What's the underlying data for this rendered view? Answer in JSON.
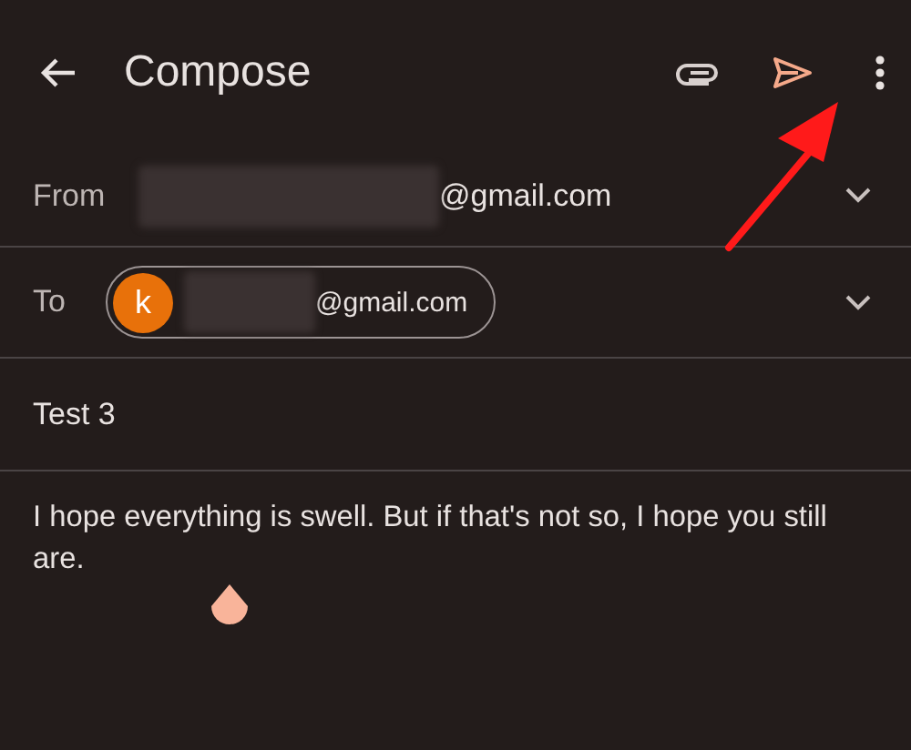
{
  "toolbar": {
    "title": "Compose"
  },
  "from": {
    "label": "From",
    "email_suffix": "@gmail.com"
  },
  "to": {
    "label": "To",
    "recipients": [
      {
        "initial": "k",
        "email_suffix": "@gmail.com",
        "color": "#e8710a"
      }
    ]
  },
  "subject": {
    "value": "Test 3"
  },
  "body": {
    "value": "I hope everything is swell. But if that's not so, I hope you still are."
  }
}
